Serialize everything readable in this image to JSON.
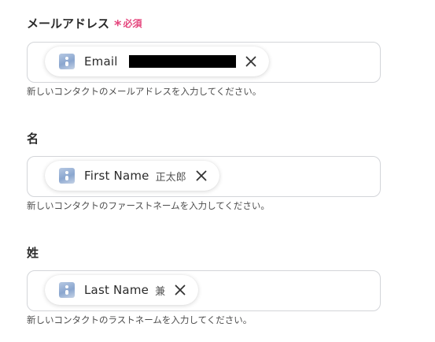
{
  "fields": [
    {
      "label": "メールアドレス",
      "required_label": "必須",
      "chip_name": "Email",
      "chip_value": "",
      "hint": "新しいコンタクトのメールアドレスを入力してください。"
    },
    {
      "label": "名",
      "chip_name": "First Name",
      "chip_value": "正太郎",
      "hint": "新しいコンタクトのファーストネームを入力してください。"
    },
    {
      "label": "姓",
      "chip_name": "Last Name",
      "chip_value": "兼",
      "hint": "新しいコンタクトのラストネームを入力してください。"
    }
  ],
  "colors": {
    "required": "#e5477e",
    "border": "#d3d5d9",
    "text": "#2b2b2b",
    "hint": "#4d4d4d"
  },
  "icons": {
    "chip": "data-source-icon",
    "remove": "close-icon",
    "required": "asterisk-icon"
  }
}
